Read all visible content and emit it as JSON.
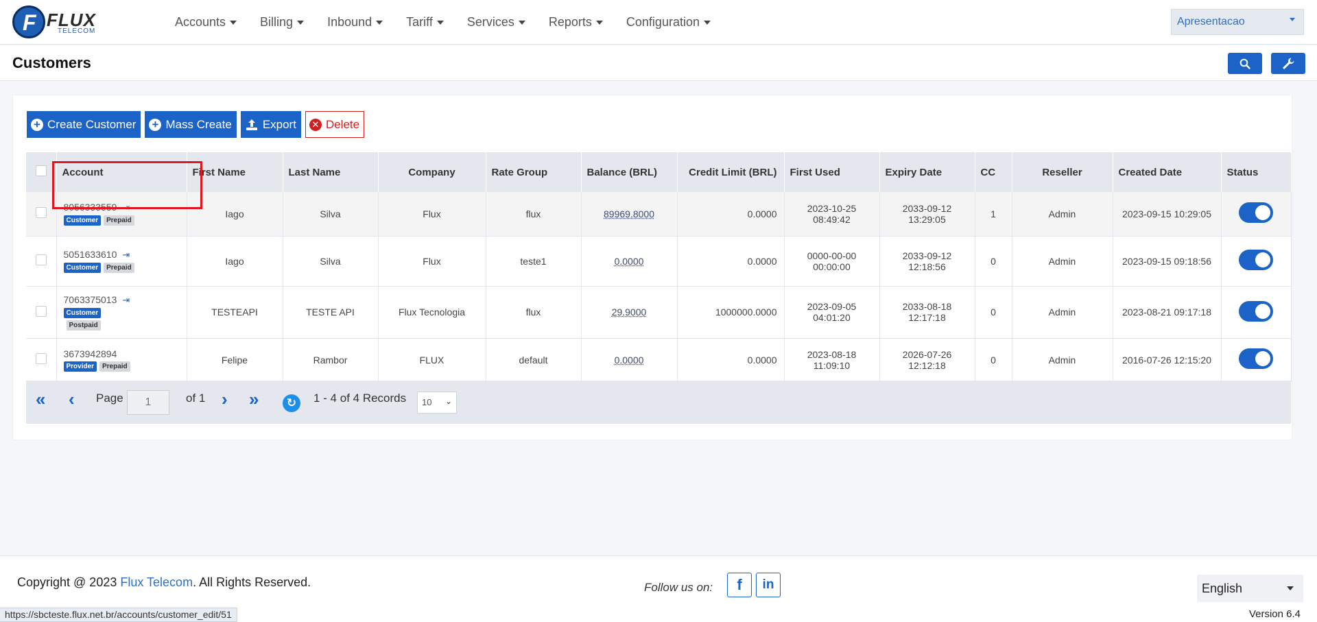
{
  "brand": {
    "logo_letter": "F",
    "name": "FLUX",
    "sub": "TELECOM"
  },
  "nav": [
    {
      "label": "Accounts"
    },
    {
      "label": "Billing"
    },
    {
      "label": "Inbound"
    },
    {
      "label": "Tariff"
    },
    {
      "label": "Services"
    },
    {
      "label": "Reports"
    },
    {
      "label": "Configuration"
    }
  ],
  "account_selector": {
    "value": "Apresentacao"
  },
  "page": {
    "title": "Customers"
  },
  "toolbar": {
    "create": "Create Customer",
    "mass_create": "Mass Create",
    "export": "Export",
    "delete": "Delete"
  },
  "table": {
    "headers": {
      "account": "Account",
      "first_name": "First Name",
      "last_name": "Last Name",
      "company": "Company",
      "rate_group": "Rate Group",
      "balance": "Balance (BRL)",
      "credit_limit": "Credit Limit (BRL)",
      "first_used": "First Used",
      "expiry_date": "Expiry Date",
      "cc": "CC",
      "reseller": "Reseller",
      "created_date": "Created Date",
      "status": "Status"
    },
    "rows": [
      {
        "account": "8056333559",
        "type": "Customer",
        "billing": "Prepaid",
        "first_name": "Iago",
        "last_name": "Silva",
        "company": "Flux",
        "rate_group": "flux",
        "balance": "89969.8000",
        "credit_limit": "0.0000",
        "first_used": "2023-10-25 08:49:42",
        "expiry_date": "2033-09-12 13:29:05",
        "cc": "1",
        "reseller": "Admin",
        "created_date": "2023-09-15 10:29:05",
        "status": true
      },
      {
        "account": "5051633610",
        "type": "Customer",
        "billing": "Prepaid",
        "first_name": "Iago",
        "last_name": "Silva",
        "company": "Flux",
        "rate_group": "teste1",
        "balance": "0.0000",
        "credit_limit": "0.0000",
        "first_used": "0000-00-00 00:00:00",
        "expiry_date": "2033-09-12 12:18:56",
        "cc": "0",
        "reseller": "Admin",
        "created_date": "2023-09-15 09:18:56",
        "status": true
      },
      {
        "account": "7063375013",
        "type": "Customer",
        "billing": "Postpaid",
        "first_name": "TESTEAPI",
        "last_name": "TESTE API",
        "company": "Flux Tecnologia",
        "rate_group": "flux",
        "balance": "29.9000",
        "credit_limit": "1000000.0000",
        "first_used": "2023-09-05 04:01:20",
        "expiry_date": "2033-08-18 12:17:18",
        "cc": "0",
        "reseller": "Admin",
        "created_date": "2023-08-21 09:17:18",
        "status": true
      },
      {
        "account": "3673942894",
        "type": "Provider",
        "billing": "Prepaid",
        "first_name": "Felipe",
        "last_name": "Rambor",
        "company": "FLUX",
        "rate_group": "default",
        "balance": "0.0000",
        "credit_limit": "0.0000",
        "first_used": "2023-08-18 11:09:10",
        "expiry_date": "2026-07-26 12:12:18",
        "cc": "0",
        "reseller": "Admin",
        "created_date": "2016-07-26 12:15:20",
        "status": true
      }
    ]
  },
  "pager": {
    "page_label": "Page",
    "page_value": "1",
    "of_label": "of 1",
    "records": "1 - 4 of 4 Records",
    "per_page": "10"
  },
  "footer": {
    "copyright_prefix": "Copyright @ 2023 ",
    "copyright_link": "Flux Telecom",
    "copyright_suffix": ". All Rights Reserved.",
    "follow": "Follow us on:",
    "facebook": "f",
    "linkedin": "in",
    "language": "English",
    "version": "Version 6.4"
  },
  "status_url": "https://sbcteste.flux.net.br/accounts/customer_edit/51",
  "colors": {
    "primary": "#1b63c6",
    "danger": "#d21f1f",
    "highlight": "#e0171f"
  }
}
